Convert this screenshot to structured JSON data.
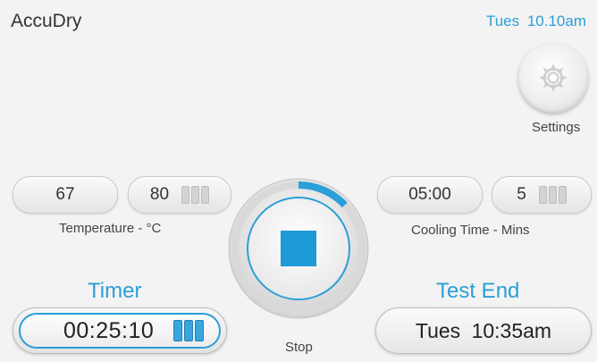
{
  "header": {
    "app_title": "AccuDry",
    "clock": "Tues  10.10am"
  },
  "settings": {
    "label": "Settings",
    "icon": "gear-icon"
  },
  "temperature": {
    "current": "67",
    "setpoint": "80",
    "label": "Temperature - °C"
  },
  "cooling": {
    "current": "05:00",
    "setpoint": "5",
    "label": "Cooling Time - Mins"
  },
  "stop": {
    "label": "Stop",
    "icon": "stop-square-icon",
    "progress_fraction": 0.13
  },
  "timer": {
    "heading": "Timer",
    "value": "00:25:10"
  },
  "test_end": {
    "heading": "Test End",
    "value": "Tues  10:35am"
  },
  "colors": {
    "accent": "#2a9fd8",
    "background": "#f3f3f3"
  }
}
